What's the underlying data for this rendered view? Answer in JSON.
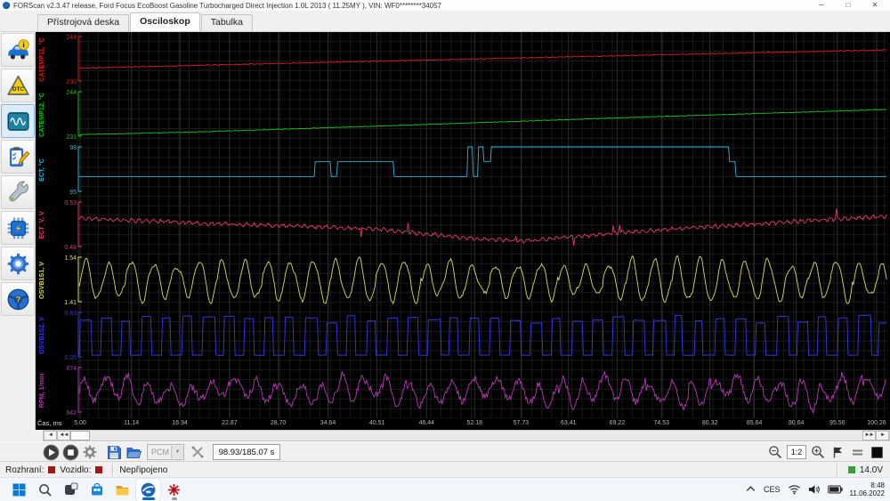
{
  "window": {
    "title": "FORScan v2.3.47 release, Ford Focus EcoBoost Gasoline Turbocharged Direct Injection 1.0L 2013 ( 11.25MY ), VIN: WF0********34057",
    "minimize": "─",
    "maximize": "□",
    "close": "✕"
  },
  "tabs": {
    "dashboard": "Přístrojová deska",
    "oscilloscope": "Osciloskop",
    "table": "Tabulka"
  },
  "sidebar": {
    "icons": [
      "vehicle-info",
      "dtc",
      "oscilloscope",
      "tests",
      "service",
      "programming",
      "settings",
      "help"
    ]
  },
  "chart_data": {
    "type": "line",
    "title": "Osciloskop",
    "xlabel": "Čas, ms",
    "x_range": [
      5,
      100.26
    ],
    "grid": true,
    "legend_position": "left-rotated",
    "x_ticks": [
      "5.00",
      "11.14",
      "16.94",
      "22.87",
      "28.70",
      "34.64",
      "40.51",
      "46.44",
      "52.18",
      "57.73",
      "63.41",
      "69.22",
      "74.53",
      "80.32",
      "85.64",
      "90.64",
      "95.56",
      "100.26"
    ],
    "channels": [
      {
        "name": "CATEMP11, °C",
        "color": "#dd1c1c",
        "min": 230,
        "max": 244,
        "min_label": "230",
        "max_label": "244",
        "wave": {
          "kind": "line",
          "seed": 11,
          "noise": 0.14,
          "points": [
            [
              4,
              234.0
            ],
            [
              30,
              235.6
            ],
            [
              60,
              237.4
            ],
            [
              101.5,
              239.8
            ]
          ]
        }
      },
      {
        "name": "CATEMP12, °C",
        "color": "#17c317",
        "min": 231,
        "max": 244,
        "min_label": "231",
        "max_label": "244",
        "wave": {
          "kind": "line",
          "seed": 12,
          "noise": 0.1,
          "points": [
            [
              4,
              231.4
            ],
            [
              20,
              232.3
            ],
            [
              45,
              234.3
            ],
            [
              70,
              236.4
            ],
            [
              101.5,
              238.8
            ]
          ]
        }
      },
      {
        "name": "ECT, °C",
        "color": "#2fb6d9",
        "min": 95,
        "max": 98,
        "min_label": "95",
        "max_label": "98",
        "wave": {
          "kind": "step",
          "seed": 13,
          "points": [
            [
              4,
              96
            ],
            [
              33,
              97
            ],
            [
              35,
              96
            ],
            [
              35.8,
              97
            ],
            [
              42.5,
              96
            ],
            [
              51.3,
              98
            ],
            [
              51.9,
              96
            ],
            [
              52.6,
              98
            ],
            [
              53.3,
              97
            ],
            [
              54.1,
              98
            ],
            [
              82.6,
              97
            ],
            [
              83.4,
              96
            ],
            [
              101.5,
              96
            ]
          ]
        }
      },
      {
        "name": "ECT_V, V",
        "color": "#e23a68",
        "min": 0.48,
        "max": 0.53,
        "min_label": "0.48",
        "max_label": "0.53",
        "wave": {
          "kind": "line",
          "seed": 14,
          "noise": 0.0026,
          "spikes": 0.013,
          "points": [
            [
              4,
              0.512
            ],
            [
              20,
              0.506
            ],
            [
              40,
              0.5
            ],
            [
              52,
              0.489
            ],
            [
              58,
              0.486
            ],
            [
              70,
              0.496
            ],
            [
              85,
              0.505
            ],
            [
              101.5,
              0.514
            ]
          ]
        }
      },
      {
        "name": "OSVB1S1, V",
        "color": "#d9d966",
        "min": 1.41,
        "max": 1.54,
        "min_label": "1.41",
        "max_label": "1.54",
        "wave": {
          "kind": "sine",
          "seed": 15,
          "base": 1.472,
          "amp": 0.05,
          "period": 2.72,
          "noise": 0.004
        }
      },
      {
        "name": "OSVB1S2, V",
        "color": "#3939e8",
        "min": 0.05,
        "max": 0.83,
        "min_label": "0.05",
        "max_label": "0.83",
        "wave": {
          "kind": "square",
          "seed": 16,
          "low": 0.08,
          "high": 0.78,
          "period": 2.45,
          "duty": 0.5,
          "jitter": 0.26,
          "hjitter": 0.18
        }
      },
      {
        "name": "RPM, 1/min",
        "color": "#b33ab3",
        "min": 842,
        "max": 874,
        "min_label": "842",
        "max_label": "874",
        "wave": {
          "kind": "noisy",
          "seed": 17,
          "base": 857,
          "amp": 8.5,
          "period": 2.6,
          "noise": 2.6
        }
      }
    ]
  },
  "scrollbar": {
    "left": "◄",
    "left_double": "◄◄",
    "right": "►",
    "right_double": "►►"
  },
  "transport": {
    "module": "PCM",
    "dropdown_arrow": "▼",
    "time_display": "98.93/185.07 s",
    "zoom_ratio": "1:2"
  },
  "statusbar": {
    "interface_label": "Rozhraní:",
    "vehicle_label": "Vozidlo:",
    "status": "Nepřipojeno",
    "voltage": "14.0V",
    "interface_color": "#a01818",
    "vehicle_color": "#a01818",
    "voltage_color": "#2fa32f"
  },
  "taskbar": {
    "language": "CES",
    "clock_time": "8:48",
    "clock_date": "11.06.2022"
  }
}
